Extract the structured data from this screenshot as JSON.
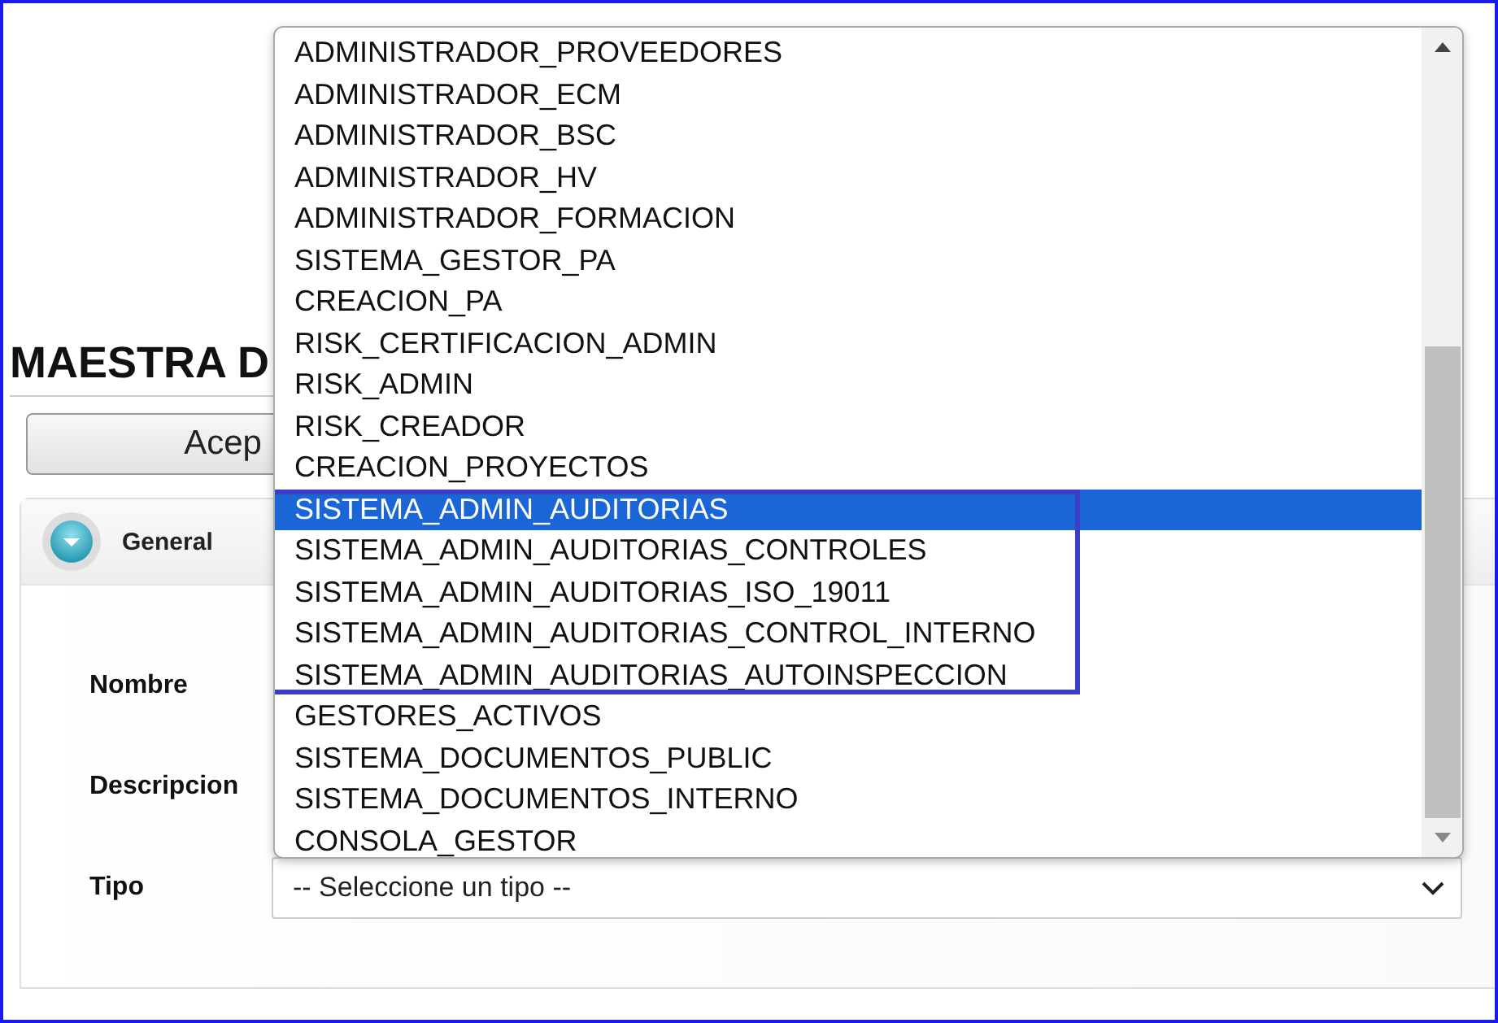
{
  "page": {
    "title": "MAESTRA D",
    "accept_button": "Acep"
  },
  "panel": {
    "title": "General",
    "fields": [
      {
        "label": "Nombre",
        "kind": "text"
      },
      {
        "label": "Descripcion",
        "kind": "text"
      },
      {
        "label": "Tipo",
        "kind": "select",
        "value": "-- Seleccione un tipo --"
      }
    ]
  },
  "dropdown": {
    "options": [
      {
        "label": "ADMINISTRADOR_PROVEEDORES",
        "selected": false,
        "highlighted": false
      },
      {
        "label": "ADMINISTRADOR_ECM",
        "selected": false,
        "highlighted": false
      },
      {
        "label": "ADMINISTRADOR_BSC",
        "selected": false,
        "highlighted": false
      },
      {
        "label": "ADMINISTRADOR_HV",
        "selected": false,
        "highlighted": false
      },
      {
        "label": "ADMINISTRADOR_FORMACION",
        "selected": false,
        "highlighted": false
      },
      {
        "label": "SISTEMA_GESTOR_PA",
        "selected": false,
        "highlighted": false
      },
      {
        "label": "CREACION_PA",
        "selected": false,
        "highlighted": false
      },
      {
        "label": "RISK_CERTIFICACION_ADMIN",
        "selected": false,
        "highlighted": false
      },
      {
        "label": "RISK_ADMIN",
        "selected": false,
        "highlighted": false
      },
      {
        "label": "RISK_CREADOR",
        "selected": false,
        "highlighted": false
      },
      {
        "label": "CREACION_PROYECTOS",
        "selected": false,
        "highlighted": false
      },
      {
        "label": "SISTEMA_ADMIN_AUDITORIAS",
        "selected": true,
        "highlighted": true
      },
      {
        "label": "SISTEMA_ADMIN_AUDITORIAS_CONTROLES",
        "selected": false,
        "highlighted": true
      },
      {
        "label": "SISTEMA_ADMIN_AUDITORIAS_ISO_19011",
        "selected": false,
        "highlighted": true
      },
      {
        "label": "SISTEMA_ADMIN_AUDITORIAS_CONTROL_INTERNO",
        "selected": false,
        "highlighted": true
      },
      {
        "label": "SISTEMA_ADMIN_AUDITORIAS_AUTOINSPECCION",
        "selected": false,
        "highlighted": true
      },
      {
        "label": "GESTORES_ACTIVOS",
        "selected": false,
        "highlighted": false
      },
      {
        "label": "SISTEMA_DOCUMENTOS_PUBLIC",
        "selected": false,
        "highlighted": false
      },
      {
        "label": "SISTEMA_DOCUMENTOS_INTERNO",
        "selected": false,
        "highlighted": false
      },
      {
        "label": "CONSOLA_GESTOR",
        "selected": false,
        "highlighted": false
      }
    ]
  }
}
